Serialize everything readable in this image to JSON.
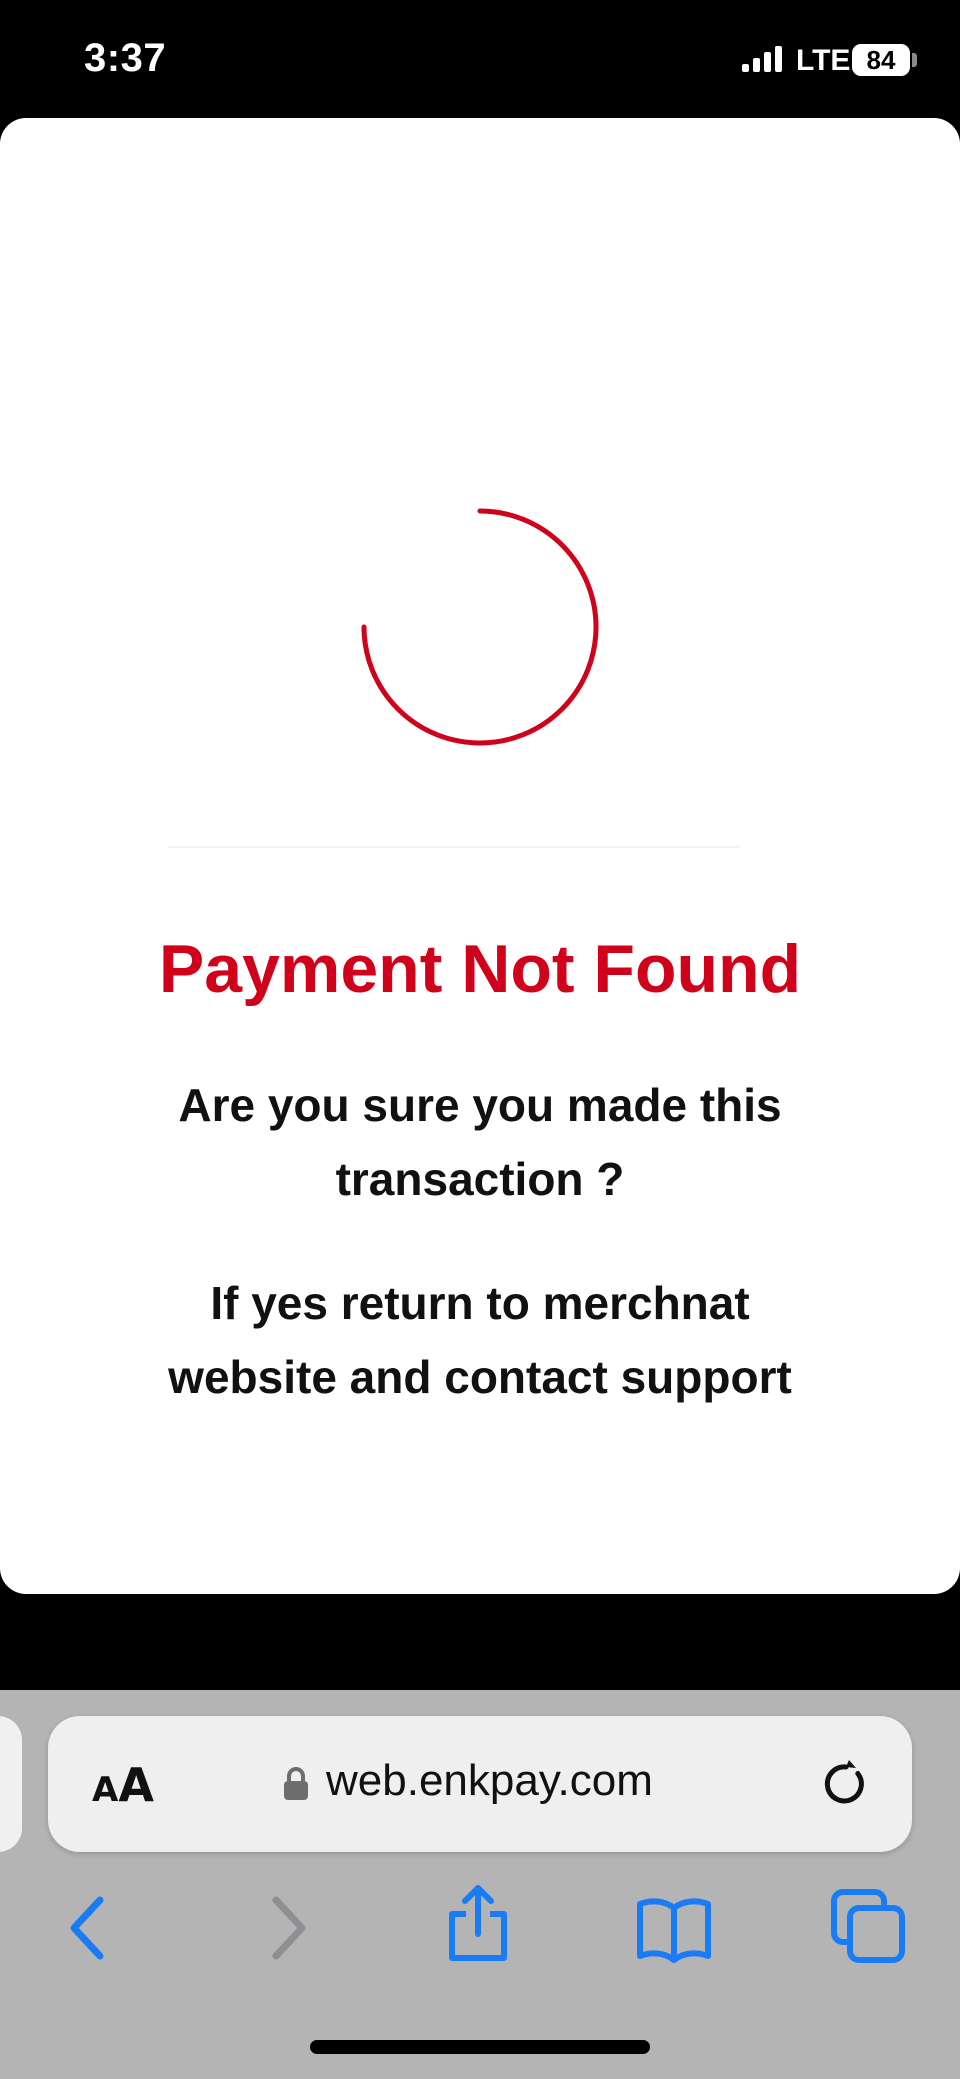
{
  "status_bar": {
    "time": "3:37",
    "network": "LTE",
    "battery": "84",
    "icons": [
      "cellular-signal-icon",
      "battery-icon"
    ]
  },
  "page": {
    "spinner_color": "#d0021b",
    "title": "Payment Not Found",
    "title_color": "#d0021b",
    "message_1": "Are you sure you made this transaction ?",
    "message_2": "If yes return to merchnat website and contact support"
  },
  "browser": {
    "reader_small": "A",
    "reader_large": "A",
    "url": "web.enkpay.com",
    "accent_color": "#1a7cf5",
    "icons": [
      "lock-icon",
      "reload-icon",
      "back-icon",
      "forward-icon",
      "share-icon",
      "bookmarks-icon",
      "tabs-icon"
    ]
  }
}
